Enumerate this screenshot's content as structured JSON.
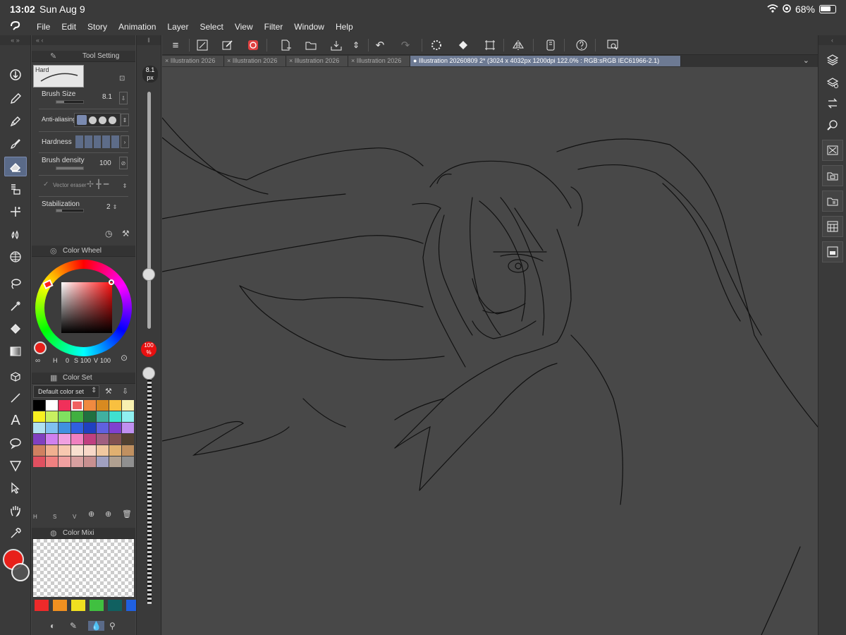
{
  "status_bar": {
    "time": "13:02",
    "date": "Sun Aug 9",
    "battery": "68%"
  },
  "menu": {
    "items": [
      "File",
      "Edit",
      "Story",
      "Animation",
      "Layer",
      "Select",
      "View",
      "Filter",
      "Window",
      "Help"
    ]
  },
  "tool_property": {
    "tab_label": "Tool Setting",
    "brush_name": "Hard",
    "brush_size_label": "Brush Size",
    "brush_size_value": "8.1",
    "anti_aliasing_label": "Anti-aliasing",
    "hardness_label": "Hardness",
    "brush_density_label": "Brush density",
    "brush_density_value": "100",
    "vector_eraser_label": "Vector eraser",
    "stabilization_label": "Stabilization",
    "stabilization_value": "2"
  },
  "color_wheel": {
    "tab_label": "Color Wheel",
    "h_label": "H",
    "h_value": "0",
    "s_label": "S",
    "s_value": "100",
    "v_label": "V",
    "v_value": "100"
  },
  "color_set": {
    "tab_label": "Color Set",
    "selected_set": "Default color set",
    "swatches": [
      "#000000",
      "#ffffff",
      "#f0305a",
      "#f06060",
      "#f08a40",
      "#d88a20",
      "#f8c040",
      "#f8f0b0",
      "#f8f020",
      "#c8f060",
      "#80e060",
      "#40b040",
      "#207040",
      "#40b0a0",
      "#40e0d0",
      "#90f0f0",
      "#b0e0f0",
      "#80c0f0",
      "#4090e0",
      "#3060e0",
      "#2040c0",
      "#6060e0",
      "#8040d0",
      "#c090f0",
      "#8040c0",
      "#d080f0",
      "#f0a0e0",
      "#f080c0",
      "#c04080",
      "#a06080",
      "#805050",
      "#504030",
      "#d08060",
      "#f0b090",
      "#f8c8b0",
      "#f8e0d0",
      "#f8d8c8",
      "#f0c8a0",
      "#e0b070",
      "#c09060",
      "#e05060",
      "#f08080",
      "#f0a0a0",
      "#d8a0a0",
      "#c89090",
      "#a0a0c0",
      "#b0a090",
      "#909090"
    ],
    "selected_index": 3,
    "bottom_labels": [
      "H",
      "S",
      "V"
    ]
  },
  "color_mixing": {
    "tab_label": "Color Mixi",
    "swatches": [
      "#ee2a2a",
      "#f09020",
      "#f0e020",
      "#40c040",
      "#106060",
      "#2060e0"
    ]
  },
  "size_slider": {
    "value_text": "8.1",
    "unit": "px",
    "size_level": 0.23,
    "opacity_text": "100",
    "opacity_unit": "%",
    "opacity_level": 1.0
  },
  "tabs": [
    {
      "label": "Illustration 2026",
      "active": false
    },
    {
      "label": "Illustration 2026",
      "active": false
    },
    {
      "label": "Illustration 2026",
      "active": false
    },
    {
      "label": "Illustration 2026",
      "active": false
    },
    {
      "label": "Illustration 20260809 2* (3024 x 4032px 1200dpi 122.0% : RGB:sRGB IEC61966-2.1)",
      "active": true
    }
  ],
  "icons": {
    "close": "×",
    "menu": "≡",
    "undo": "↶",
    "redo": "↷",
    "up_down": "⇕",
    "tool_move": "⇩",
    "tool_pen": "✎",
    "tool_eraser": "⌫"
  },
  "colors": {
    "main_color": "#e8201a",
    "accent": "#6d7a93",
    "canvas": "#484848"
  }
}
